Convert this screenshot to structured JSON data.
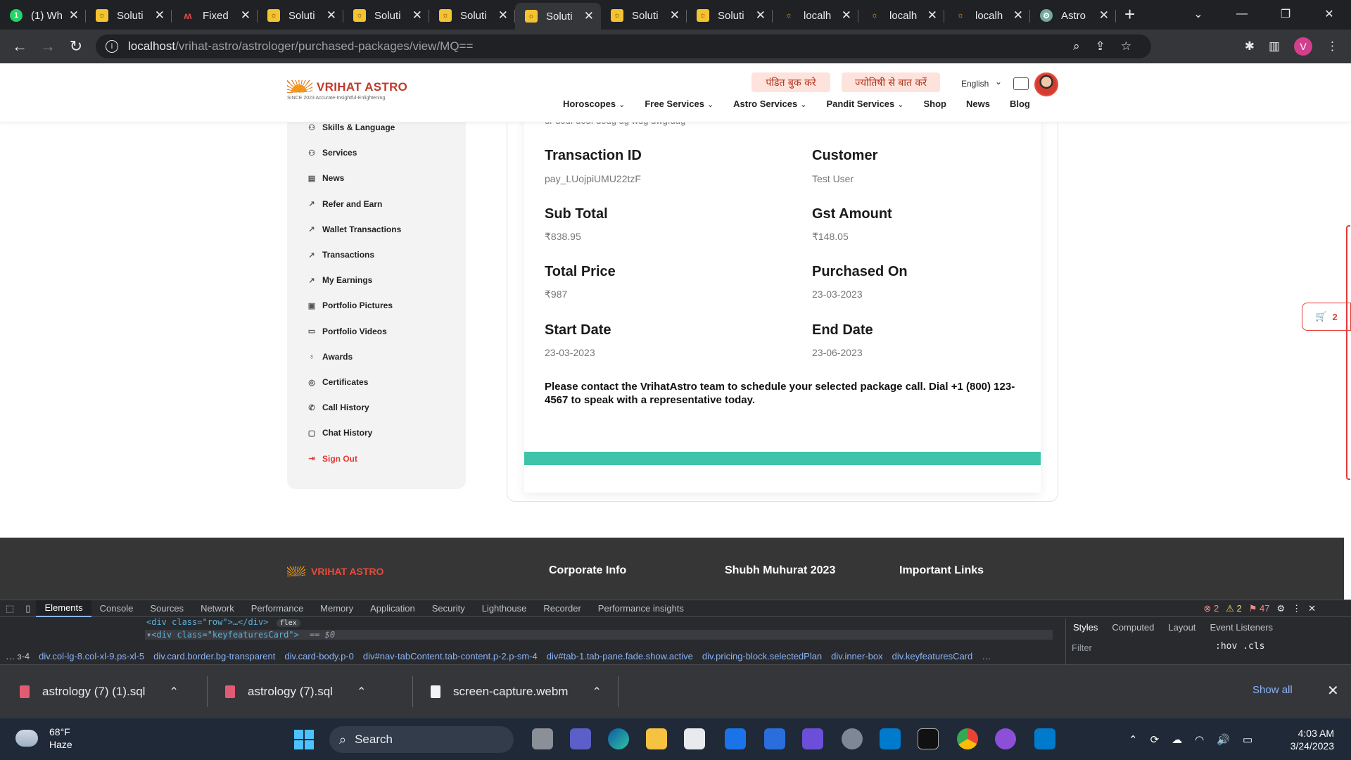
{
  "browser": {
    "tabs": [
      {
        "title": "(1) Wh",
        "icon": "whatsapp-icon"
      },
      {
        "title": "Soluti",
        "icon": "vrihat-icon"
      },
      {
        "title": "Fixed",
        "icon": "ai-icon"
      },
      {
        "title": "Soluti",
        "icon": "vrihat-icon"
      },
      {
        "title": "Soluti",
        "icon": "vrihat-icon"
      },
      {
        "title": "Soluti",
        "icon": "vrihat-icon"
      },
      {
        "title": "Soluti",
        "icon": "vrihat-icon",
        "active": true
      },
      {
        "title": "Soluti",
        "icon": "vrihat-icon"
      },
      {
        "title": "Soluti",
        "icon": "vrihat-icon"
      },
      {
        "title": "localh",
        "icon": "localhost-icon"
      },
      {
        "title": "localh",
        "icon": "localhost-icon"
      },
      {
        "title": "localh",
        "icon": "localhost-icon"
      },
      {
        "title": "Astro",
        "icon": "chatgpt-icon"
      }
    ],
    "url_host": "localhost",
    "url_path": "/vrihat-astro/astrologer/purchased-packages/view/MQ==",
    "profile_initial": "V"
  },
  "site": {
    "logo_name": "VRIHAT ASTRO",
    "logo_tagline": "SINCE 2023   Accurate-Insightful-Enlightening",
    "pill_pandit": "पंडित बुक करे",
    "pill_jyotishi": "ज्योतिषी से बात करें",
    "language": "English",
    "nav": [
      {
        "label": "Horoscopes",
        "dropdown": true
      },
      {
        "label": "Free Services",
        "dropdown": true
      },
      {
        "label": "Astro Services",
        "dropdown": true
      },
      {
        "label": "Pandit Services",
        "dropdown": true
      },
      {
        "label": "Shop",
        "dropdown": false
      },
      {
        "label": "News",
        "dropdown": false
      },
      {
        "label": "Blog",
        "dropdown": false
      }
    ],
    "cart_count": "2"
  },
  "sidebar": {
    "items": [
      {
        "label": "Skills & Language",
        "icon": "users-icon"
      },
      {
        "label": "Services",
        "icon": "users-icon"
      },
      {
        "label": "News",
        "icon": "newspaper-icon"
      },
      {
        "label": "Refer and Earn",
        "icon": "chart-icon"
      },
      {
        "label": "Wallet Transactions",
        "icon": "chart-icon"
      },
      {
        "label": "Transactions",
        "icon": "chart-icon"
      },
      {
        "label": "My Earnings",
        "icon": "chart-icon"
      },
      {
        "label": "Portfolio Pictures",
        "icon": "image-icon"
      },
      {
        "label": "Portfolio Videos",
        "icon": "video-icon"
      },
      {
        "label": "Awards",
        "icon": "award-icon"
      },
      {
        "label": "Certificates",
        "icon": "certificate-icon"
      },
      {
        "label": "Call History",
        "icon": "phone-icon"
      },
      {
        "label": "Chat History",
        "icon": "chat-icon"
      },
      {
        "label": "Sign Out",
        "icon": "sign-out-icon"
      }
    ]
  },
  "package": {
    "cut_text": "dr dodf dodf dodg dg wdg dwgfddg",
    "fields": {
      "transaction_id_label": "Transaction ID",
      "transaction_id_value": "pay_LUojpiUMU22tzF",
      "customer_label": "Customer",
      "customer_value": "Test User",
      "sub_total_label": "Sub Total",
      "sub_total_value": "₹838.95",
      "gst_label": "Gst Amount",
      "gst_value": "₹148.05",
      "total_label": "Total Price",
      "total_value": "₹987",
      "purchased_label": "Purchased On",
      "purchased_value": "23-03-2023",
      "start_label": "Start Date",
      "start_value": "23-03-2023",
      "end_label": "End Date",
      "end_value": "23-06-2023"
    },
    "note": "Please contact the VrihatAstro team to schedule your selected package call. Dial +1 (800) 123-4567 to speak with a representative today."
  },
  "footer": {
    "logo": "VRIHAT ASTRO",
    "headings": [
      "Corporate Info",
      "Shubh Muhurat 2023",
      "Important Links"
    ]
  },
  "devtools": {
    "tabs": [
      "Elements",
      "Console",
      "Sources",
      "Network",
      "Performance",
      "Memory",
      "Application",
      "Security",
      "Lighthouse",
      "Recorder",
      "Performance insights"
    ],
    "code_line1": "<div class=\"row\">…</div>",
    "code_line2_tag": "<div class=\"keyfeaturesCard\">",
    "code_line2_suffix": "== $0",
    "flex_badge": "flex",
    "crumbs": [
      "…  ɜ-4",
      "div.col-lg-8.col-xl-9.ps-xl-5",
      "div.card.border.bg-transparent",
      "div.card-body.p-0",
      "div#nav-tabContent.tab-content.p-2.p-sm-4",
      "div#tab-1.tab-pane.fade.show.active",
      "div.pricing-block.selectedPlan",
      "div.inner-box",
      "div.keyfeaturesCard",
      "…"
    ],
    "side_tabs": [
      "Styles",
      "Computed",
      "Layout",
      "Event Listeners"
    ],
    "filter_placeholder": "Filter",
    "hov_cls": ":hov  .cls",
    "errors": "2",
    "warnings": "2",
    "issues": "47"
  },
  "downloads": {
    "items": [
      "astrology (7) (1).sql",
      "astrology (7).sql",
      "screen-capture.webm"
    ],
    "show_all": "Show all"
  },
  "taskbar": {
    "temperature": "68°F",
    "condition": "Haze",
    "search": "Search",
    "time": "4:03 AM",
    "date": "3/24/2023"
  }
}
